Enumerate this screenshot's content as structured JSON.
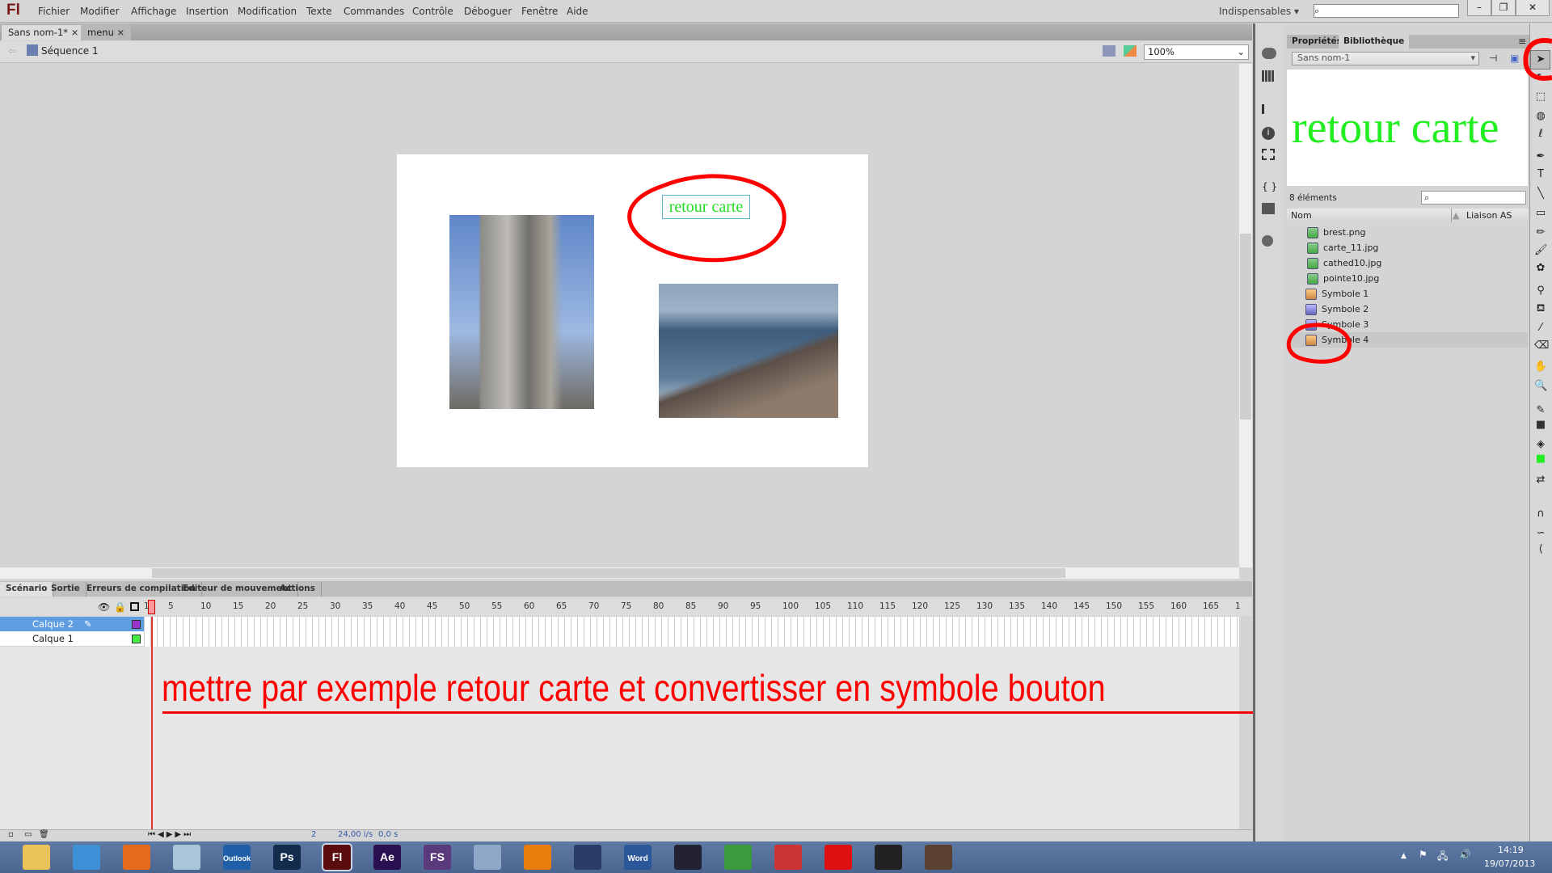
{
  "app": {
    "logo": "Fl",
    "menu": [
      "Fichier",
      "Modifier",
      "Affichage",
      "Insertion",
      "Modification",
      "Texte",
      "Commandes",
      "Contrôle",
      "Déboguer",
      "Fenêtre",
      "Aide"
    ],
    "workspace": "Indispensables",
    "window_buttons": [
      "–",
      "❐",
      "✕"
    ]
  },
  "doc_tabs": [
    {
      "label": "Sans nom-1*",
      "close": "×"
    },
    {
      "label": "menu",
      "close": "×"
    }
  ],
  "editbar": {
    "scene": "Séquence 1",
    "zoom": "100%"
  },
  "stage": {
    "text": "retour carte",
    "annotation_color": "#ff0000",
    "text_color": "#22dd22"
  },
  "timeline": {
    "tabs": [
      "Scénario",
      "Sortie",
      "Erreurs de compilation",
      "Editeur de mouvement",
      "Actions"
    ],
    "frame_numbers": [
      "1",
      "5",
      "10",
      "15",
      "20",
      "25",
      "30",
      "35",
      "40",
      "45",
      "50",
      "55",
      "60",
      "65",
      "70",
      "75",
      "80",
      "85",
      "90",
      "95",
      "100",
      "105",
      "110",
      "115",
      "120",
      "125",
      "130",
      "135",
      "140",
      "145",
      "150",
      "155",
      "160",
      "165",
      "1"
    ],
    "layers": [
      {
        "name": "Calque 2",
        "color": "#9933cc",
        "selected": true
      },
      {
        "name": "Calque 1",
        "color": "#44ee44",
        "selected": false
      }
    ],
    "status": {
      "frame": "2",
      "fps": "24,00 i/s",
      "time": "0,0 s"
    }
  },
  "annotation": "mettre par exemple  retour carte  et convertisser en symbole bouton",
  "library": {
    "tabs": [
      "Propriétés",
      "Bibliothèque"
    ],
    "document": "Sans nom-1",
    "preview_text": "retour carte",
    "count": "8 éléments",
    "columns": [
      "Nom",
      "Liaison AS"
    ],
    "items": [
      {
        "name": "brest.png",
        "type": "bitmap"
      },
      {
        "name": "carte_11.jpg",
        "type": "bitmap"
      },
      {
        "name": "cathed10.jpg",
        "type": "bitmap"
      },
      {
        "name": "pointe10.jpg",
        "type": "bitmap"
      },
      {
        "name": "Symbole 1",
        "type": "button"
      },
      {
        "name": "Symbole 2",
        "type": "movieclip"
      },
      {
        "name": "Symbole 3",
        "type": "movieclip"
      },
      {
        "name": "Symbole 4",
        "type": "button",
        "selected": true
      }
    ]
  },
  "taskbar": {
    "apps": [
      "explorer",
      "ie",
      "firefox",
      "notes",
      "Outlook",
      "Ps",
      "Fl",
      "Ae",
      "FS",
      "calc",
      "blender",
      "cinema4d",
      "Word",
      "gear",
      "chrome",
      "app",
      "opera",
      "monitor",
      "game"
    ],
    "time": "14:19",
    "date": "19/07/2013"
  }
}
